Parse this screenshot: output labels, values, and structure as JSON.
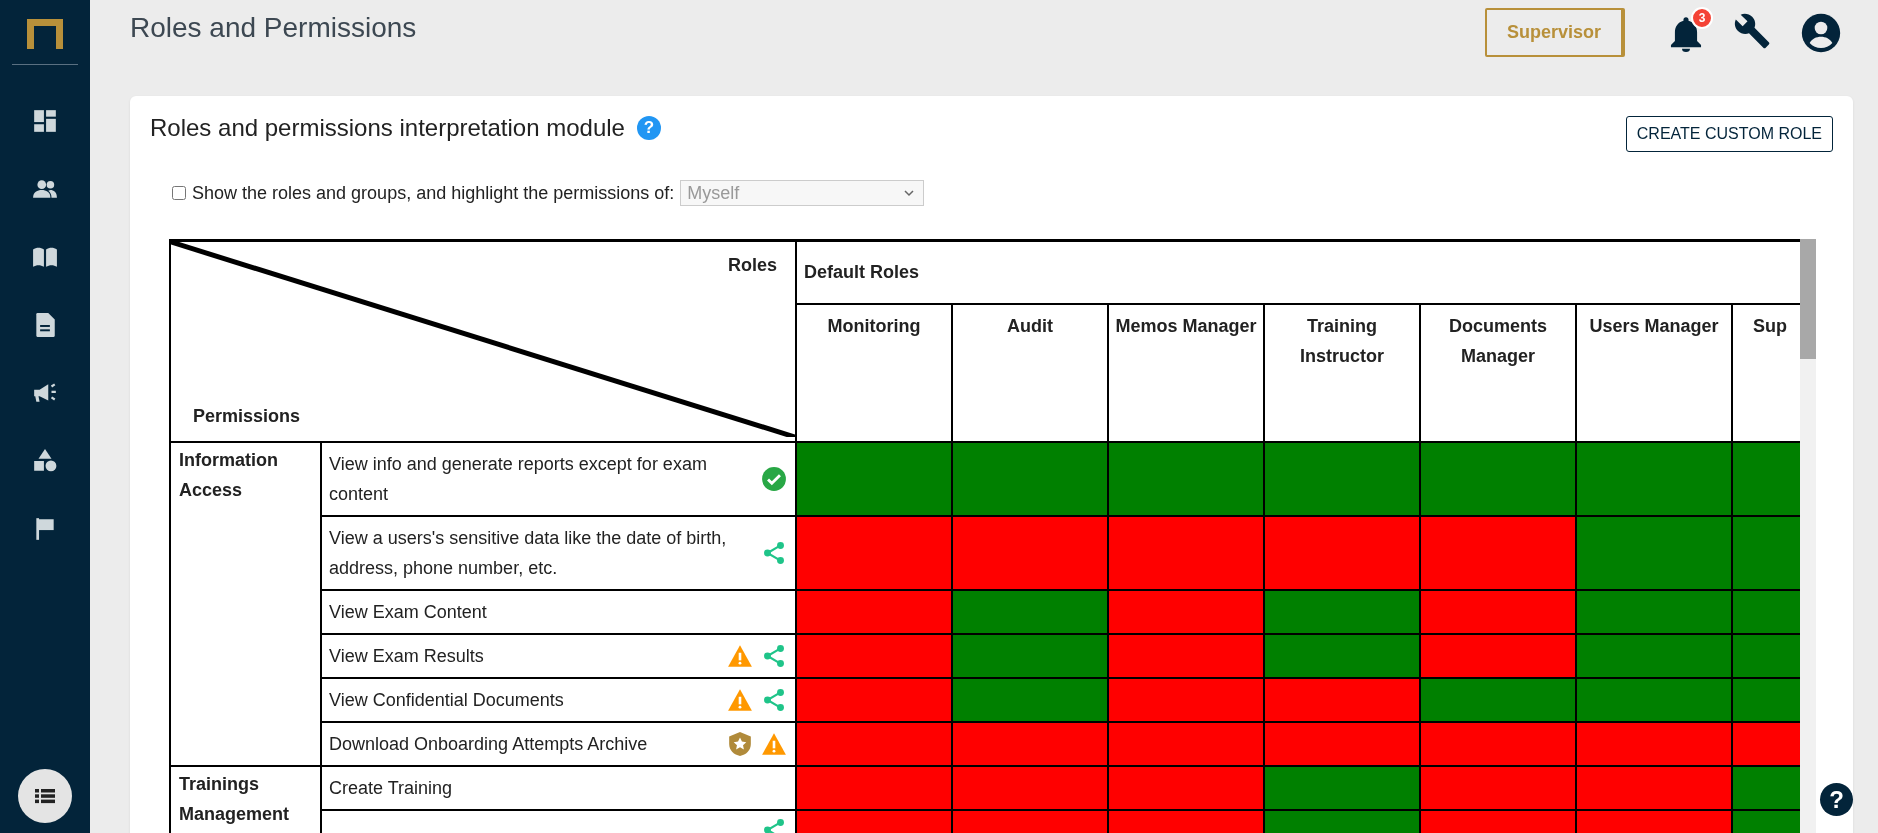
{
  "header": {
    "title": "Roles and Permissions",
    "role_button": "Supervisor",
    "notifications": "3"
  },
  "card": {
    "title": "Roles and permissions interpretation module",
    "help": "?",
    "create_button": "CREATE CUSTOM ROLE",
    "filter": {
      "label": "Show the roles and groups, and highlight the permissions of:",
      "checked": false,
      "value": "Myself"
    }
  },
  "table": {
    "corner_top": "Roles",
    "corner_bottom": "Permissions",
    "role_group": "Default Roles",
    "roles": [
      "Monitoring",
      "Audit",
      "Memos Manager",
      "Training Instructor",
      "Documents Manager",
      "Users Manager",
      "Sup"
    ],
    "groups": [
      {
        "name": "Information Access",
        "permissions": [
          {
            "name": "View info and generate reports except for exam content",
            "approved": true,
            "protected": false,
            "warning": false,
            "shared": false,
            "granted": [
              true,
              true,
              true,
              true,
              true,
              true,
              true
            ]
          },
          {
            "name": "View a users's sensitive data like the date of birth, address, phone number, etc.",
            "approved": false,
            "protected": false,
            "warning": false,
            "shared": true,
            "granted": [
              false,
              false,
              false,
              false,
              false,
              true,
              true
            ]
          },
          {
            "name": "View Exam Content",
            "approved": false,
            "protected": false,
            "warning": false,
            "shared": false,
            "granted": [
              false,
              true,
              false,
              true,
              false,
              true,
              true
            ]
          },
          {
            "name": "View Exam Results",
            "approved": false,
            "protected": false,
            "warning": true,
            "shared": true,
            "granted": [
              false,
              true,
              false,
              true,
              false,
              true,
              true
            ]
          },
          {
            "name": "View Confidential Documents",
            "approved": false,
            "protected": false,
            "warning": true,
            "shared": true,
            "granted": [
              false,
              true,
              false,
              false,
              true,
              true,
              true
            ]
          },
          {
            "name": "Download Onboarding Attempts Archive",
            "approved": false,
            "protected": true,
            "warning": true,
            "shared": false,
            "granted": [
              false,
              false,
              false,
              false,
              false,
              false,
              false
            ]
          }
        ]
      },
      {
        "name": "Trainings Management",
        "permissions": [
          {
            "name": "Create Training",
            "approved": false,
            "protected": false,
            "warning": false,
            "shared": false,
            "granted": [
              false,
              false,
              false,
              true,
              false,
              false,
              true
            ]
          },
          {
            "approved": false,
            "protected": false,
            "warning": false,
            "shared": true,
            "granted": [
              false,
              false,
              false,
              true,
              false,
              false,
              true
            ]
          }
        ]
      }
    ]
  },
  "help_button": "?"
}
